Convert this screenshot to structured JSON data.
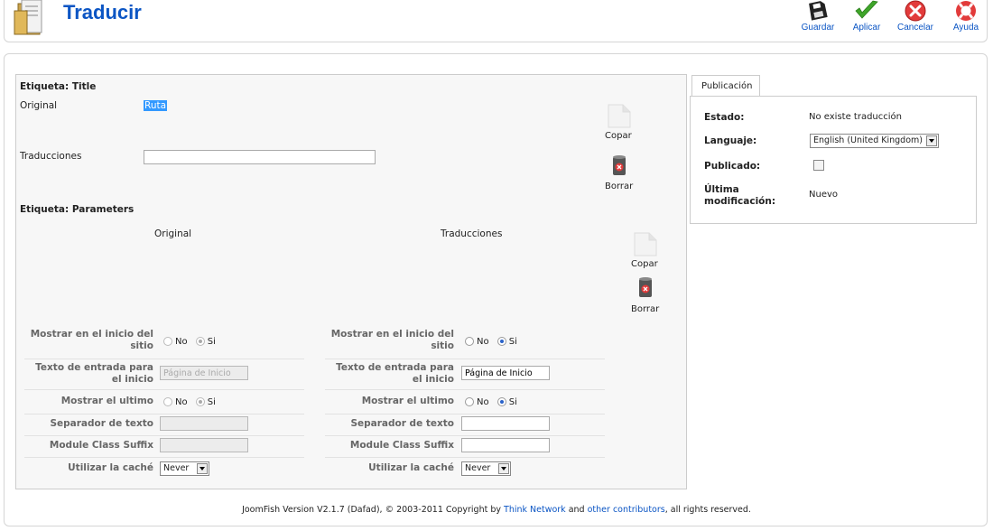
{
  "header": {
    "title": "Traducir",
    "toolbar": {
      "save_label": "Guardar",
      "apply_label": "Aplicar",
      "cancel_label": "Cancelar",
      "help_label": "Ayuda"
    }
  },
  "form": {
    "title_label": "Etiqueta: Title",
    "original_label": "Original",
    "original_value": "Ruta",
    "translations_label": "Traducciones",
    "translation_value": "",
    "copy_label": "Copar",
    "delete_label": "Borrar",
    "parameters_label": "Etiqueta: Parameters",
    "params_original_header": "Original",
    "params_translations_header": "Traducciones",
    "params": [
      {
        "label": "Mostrar en el inicio del sitio",
        "type": "radio",
        "no_label": "No",
        "si_label": "Si",
        "original_selected": "Si",
        "translation_selected": "Si"
      },
      {
        "label": "Texto de entrada para el inicio",
        "type": "text",
        "original_value": "Página de Inicio",
        "translation_value": "Página de Inicio"
      },
      {
        "label": "Mostrar el ultimo",
        "type": "radio",
        "no_label": "No",
        "si_label": "Si",
        "original_selected": "Si",
        "translation_selected": "Si"
      },
      {
        "label": "Separador de texto",
        "type": "text",
        "original_value": "",
        "translation_value": ""
      },
      {
        "label": "Module Class Suffix",
        "type": "text",
        "original_value": "",
        "translation_value": ""
      },
      {
        "label": "Utilizar la caché",
        "type": "select",
        "original_value": "Never",
        "translation_value": "Never"
      }
    ]
  },
  "publication": {
    "tab_label": "Publicación",
    "estado_label": "Estado:",
    "estado_value": "No existe traducción",
    "language_label": "Languaje:",
    "language_value": "English (United Kingdom)",
    "published_label": "Publicado:",
    "published_checked": false,
    "modified_label_1": "Última",
    "modified_label_2": "modificación:",
    "modified_value": "Nuevo"
  },
  "footer": {
    "text_before": "JoomFish Version V2.1.7 (Dafad), © 2003-2011 Copyright by ",
    "link1": "Think Network",
    "text_middle": " and ",
    "link2": "other contributors",
    "text_after": ", all rights reserved."
  },
  "colors": {
    "accent": "#0b55c4",
    "selection": "#3399ff"
  }
}
